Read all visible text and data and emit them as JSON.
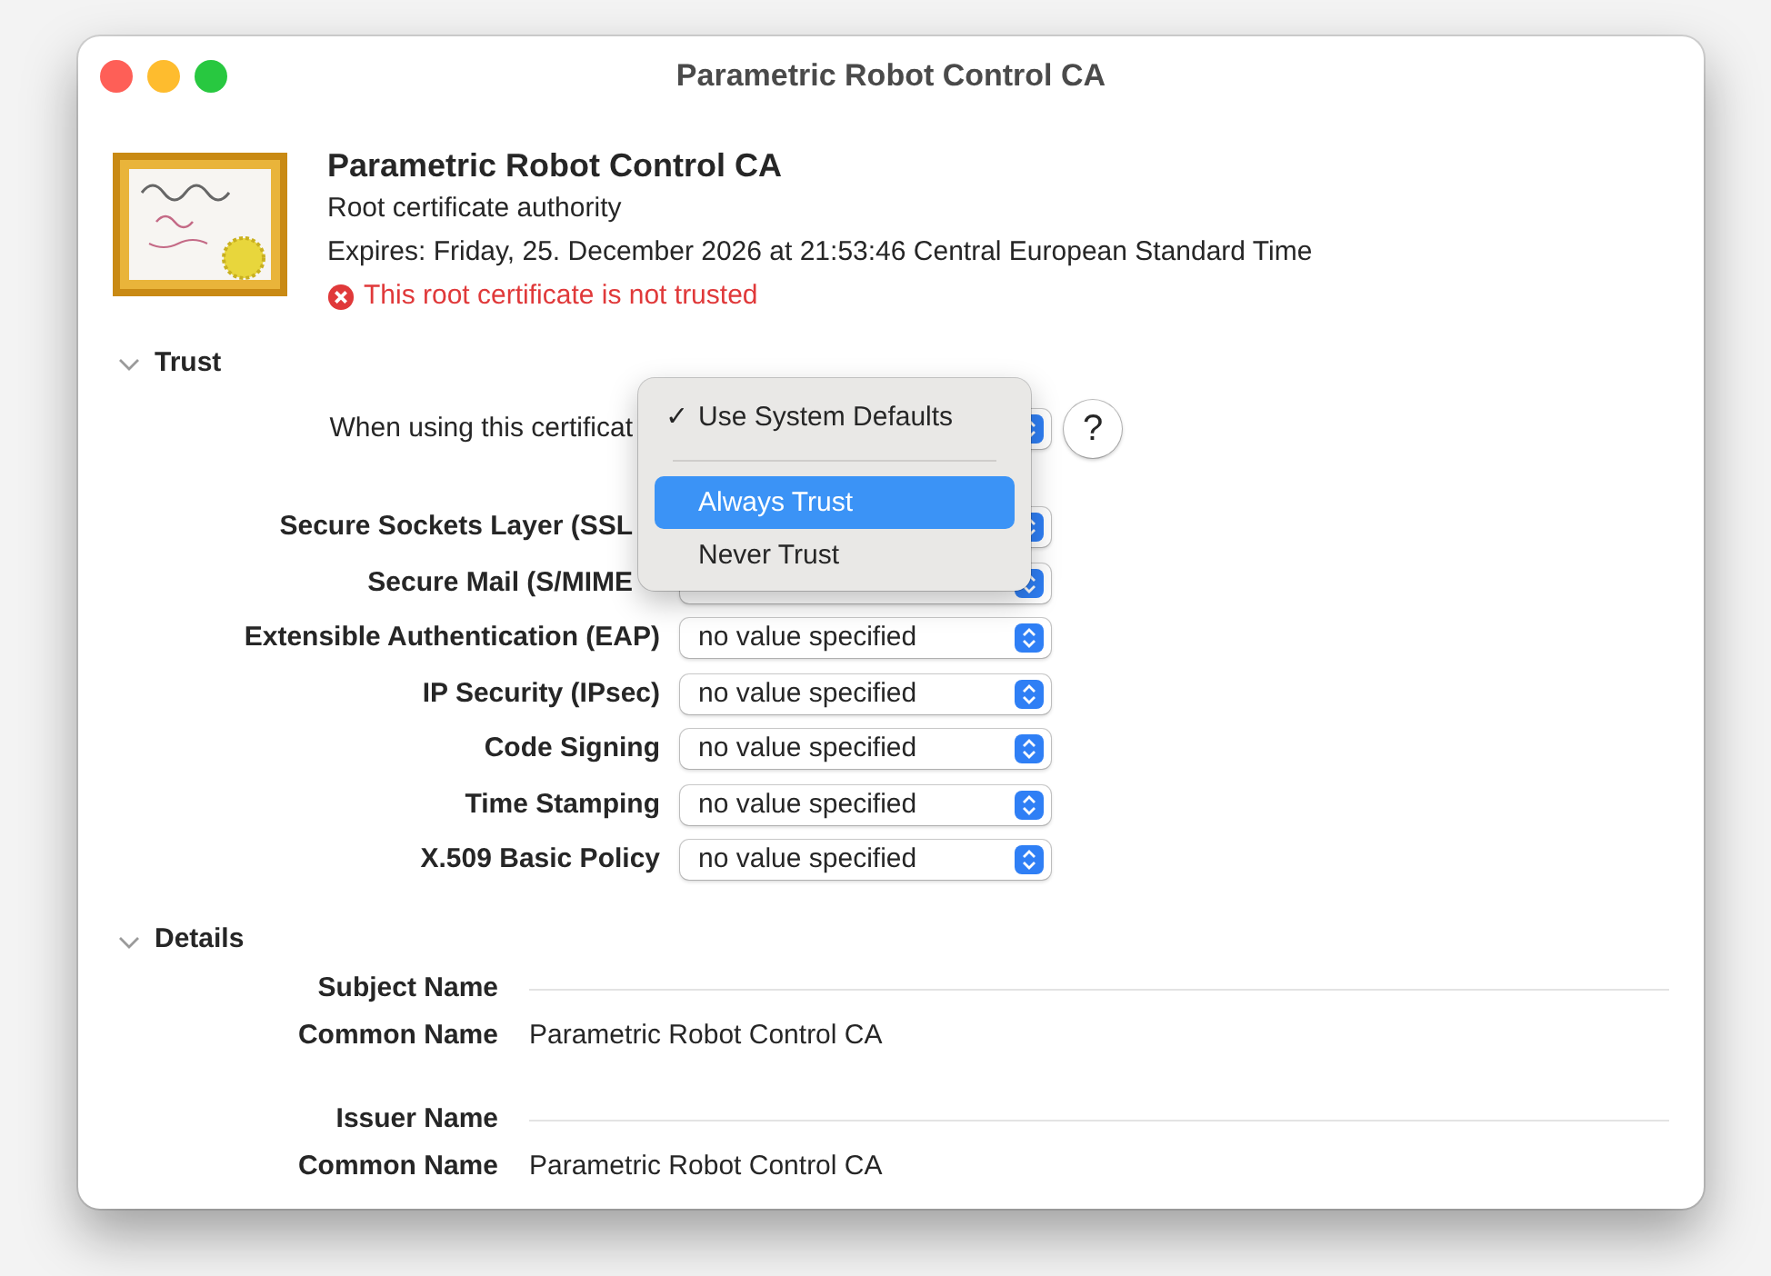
{
  "window": {
    "title": "Parametric Robot Control CA"
  },
  "header": {
    "name": "Parametric Robot Control CA",
    "subtitle": "Root certificate authority",
    "expires": "Expires: Friday, 25. December 2026 at 21:53:46 Central European Standard Time",
    "warning": "This root certificate is not trusted"
  },
  "trust": {
    "title": "Trust",
    "expanded": true,
    "help_button": "?",
    "rows": [
      {
        "kind": "primary",
        "label": "When using this certificat"
      },
      {
        "kind": "setting",
        "label": "Secure Sockets Layer (SSL"
      },
      {
        "kind": "setting",
        "label": "Secure Mail (S/MIME"
      },
      {
        "kind": "setting",
        "label": "Extensible Authentication (EAP)",
        "value": "no value specified"
      },
      {
        "kind": "setting",
        "label": "IP Security (IPsec)",
        "value": "no value specified"
      },
      {
        "kind": "setting",
        "label": "Code Signing",
        "value": "no value specified"
      },
      {
        "kind": "setting",
        "label": "Time Stamping",
        "value": "no value specified"
      },
      {
        "kind": "setting",
        "label": "X.509 Basic Policy",
        "value": "no value specified"
      }
    ],
    "menu": {
      "items": [
        {
          "kind": "option",
          "label": "Use System Defaults",
          "checked": true,
          "check_mark": "✓",
          "selected": false
        },
        {
          "kind": "separator"
        },
        {
          "kind": "option",
          "label": "Always Trust",
          "checked": false,
          "selected": true
        },
        {
          "kind": "option",
          "label": "Never Trust",
          "checked": false,
          "selected": false
        }
      ]
    }
  },
  "details": {
    "title": "Details",
    "expanded": true,
    "groups": [
      {
        "heading": "Subject Name",
        "fields": [
          {
            "label": "Common Name",
            "value": "Parametric Robot Control CA"
          }
        ]
      },
      {
        "heading": "Issuer Name",
        "fields": [
          {
            "label": "Common Name",
            "value": "Parametric Robot Control CA"
          }
        ]
      }
    ]
  }
}
